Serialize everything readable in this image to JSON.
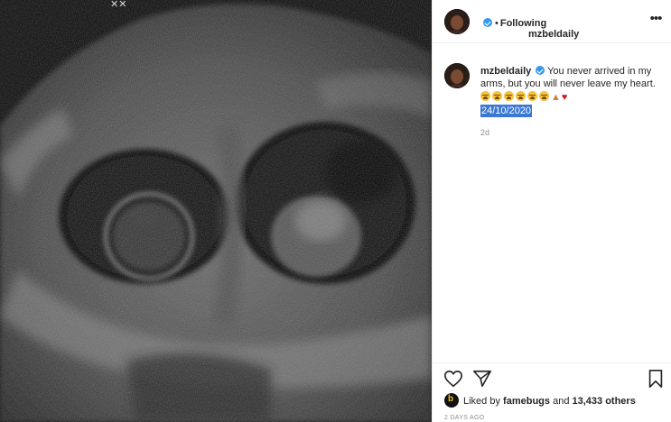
{
  "post": {
    "username": "mzbeldaily",
    "follow_state": "Following",
    "separator": "•",
    "more_label": "•••",
    "caption_text": "You never arrived in my arms, but you will never leave my heart.",
    "caption_date": "24/10/2020",
    "time_ago": "2d",
    "liked_by_prefix": "Liked by",
    "liked_by_user": "famebugs",
    "liked_by_and": "and",
    "others_count": "13,433 others",
    "posted_date": "2 DAYS AGO"
  },
  "icons": {
    "verified": "verified-badge-icon",
    "like": "heart-outline-icon",
    "share": "paper-plane-icon",
    "save": "bookmark-icon",
    "emoji_crying": "loudly-crying-face-emoji",
    "emoji_pray": "folded-hands-emoji",
    "emoji_heart": "red-heart-emoji"
  },
  "colors": {
    "verified": "#3897f0",
    "selection": "#3a78d4",
    "heart": "#d0191f"
  }
}
